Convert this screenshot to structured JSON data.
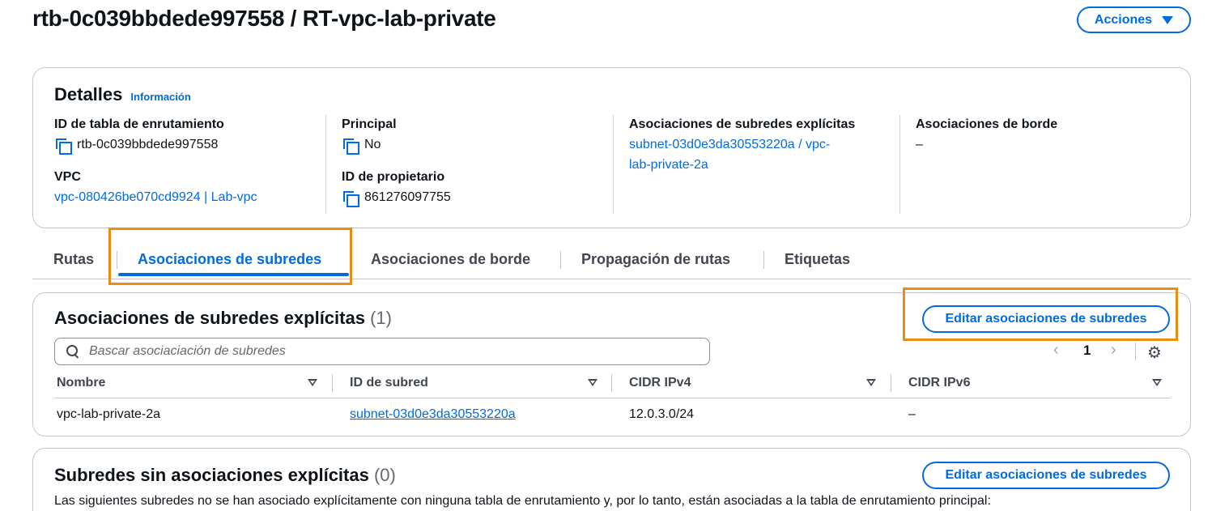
{
  "header": {
    "title": "rtb-0c039bbdede997558 / RT-vpc-lab-private",
    "actions_label": "Acciones"
  },
  "details": {
    "heading": "Detalles",
    "info_link": "Información",
    "route_table_id_label": "ID de tabla de enrutamiento",
    "route_table_id_value": "rtb-0c039bbdede997558",
    "vpc_label": "VPC",
    "vpc_value": "vpc-080426be070cd9924 | Lab-vpc",
    "main_label": "Principal",
    "main_value": "No",
    "owner_label": "ID de propietario",
    "owner_value": "861276097755",
    "explicit_label": "Asociaciones de subredes explícitas",
    "explicit_value_line1": "subnet-03d0e3da30553220a / vpc-",
    "explicit_value_line2": "lab-private-2a",
    "edge_label": "Asociaciones de borde",
    "edge_value": "–"
  },
  "tabs": [
    {
      "label": "Rutas"
    },
    {
      "label": "Asociaciones de subredes"
    },
    {
      "label": "Asociaciones de borde"
    },
    {
      "label": "Propagación de rutas"
    },
    {
      "label": "Etiquetas"
    }
  ],
  "explicit_section": {
    "title": "Asociaciones de subredes explícitas",
    "count": "(1)",
    "edit_button": "Editar asociaciones de subredes",
    "search_placeholder": "Bascar asociaciación de subredes",
    "page_number": "1",
    "columns": [
      "Nombre",
      "ID de subred",
      "CIDR IPv4",
      "CIDR IPv6"
    ],
    "rows": [
      {
        "name": "vpc-lab-private-2a",
        "subnet_id": "subnet-03d0e3da30553220a",
        "ipv4": "12.0.3.0/24",
        "ipv6": "–"
      }
    ]
  },
  "no_explicit_section": {
    "title": "Subredes sin asociaciones explícitas",
    "count": "(0)",
    "edit_button": "Editar asociaciones de subredes",
    "description": "Las siguientes subredes no se han asociado explícitamente con ninguna tabla de enrutamiento y, por lo tanto, están asociadas a la tabla de enrutamiento principal:"
  },
  "colors": {
    "accent": "#006ce0",
    "highlight": "#ec8d13",
    "text": "#0f141a"
  }
}
